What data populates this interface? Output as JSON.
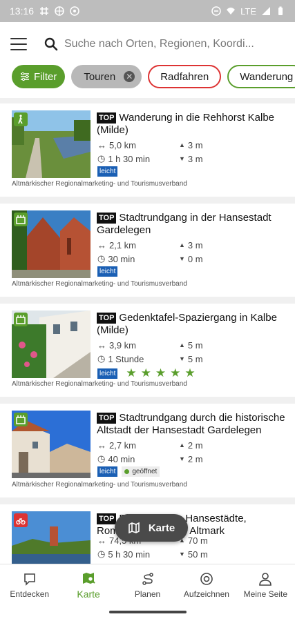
{
  "status_bar": {
    "time": "13:16",
    "network": "LTE"
  },
  "search": {
    "placeholder": "Suche nach Orten, Regionen, Koordi..."
  },
  "chips": {
    "filter": "Filter",
    "active": "Touren",
    "cycling": "Radfahren",
    "hiking": "Wanderung"
  },
  "tours": [
    {
      "top": "TOP",
      "title": "Wanderung in die Rehhorst Kalbe (Milde)",
      "distance": "5,0 km",
      "duration": "1 h 30 min",
      "ascent": "3 m",
      "descent": "3 m",
      "difficulty": "leicht",
      "org": "Altmärkischer Regionalmarketing- und Tourismusverband",
      "category_icon": "hiking-icon",
      "category_color": "#5a9e2c"
    },
    {
      "top": "TOP",
      "title": "Stadtrundgang in der Hansestadt Gardelegen",
      "distance": "2,1 km",
      "duration": "30 min",
      "ascent": "3 m",
      "descent": "0 m",
      "difficulty": "leicht",
      "org": "Altmärkischer Regionalmarketing- und Tourismusverband",
      "category_icon": "city-walk-icon",
      "category_color": "#5a9e2c"
    },
    {
      "top": "TOP",
      "title": "Gedenktafel-Spaziergang in Kalbe (Milde)",
      "distance": "3,9 km",
      "duration": "1 Stunde",
      "ascent": "5 m",
      "descent": "5 m",
      "difficulty": "leicht",
      "rating": 5,
      "org": "Altmärkischer Regionalmarketing- und Tourismusverband",
      "category_icon": "city-walk-icon",
      "category_color": "#5a9e2c"
    },
    {
      "top": "TOP",
      "title": "Stadtrundgang durch die historische Altstadt der Hansestadt Gardelegen",
      "distance": "2,7 km",
      "duration": "40 min",
      "ascent": "2 m",
      "descent": "2 m",
      "difficulty": "leicht",
      "status": "geöffnet",
      "org": "Altmärkischer Regionalmarketing- und Tourismusverband",
      "category_icon": "city-walk-icon",
      "category_color": "#5a9e2c"
    },
    {
      "top": "TOP",
      "title": "Elberadweg – Hansestädte, Romanik und ... der Altmark",
      "distance": "74,5 km",
      "duration": "5 h 30 min",
      "ascent": "70 m",
      "descent": "50 m",
      "category_icon": "cycling-icon",
      "category_color": "#d33"
    }
  ],
  "map_button": "Karte",
  "nav": [
    {
      "label": "Entdecken"
    },
    {
      "label": "Karte"
    },
    {
      "label": "Planen"
    },
    {
      "label": "Aufzeichnen"
    },
    {
      "label": "Meine Seite"
    }
  ],
  "colors": {
    "accent": "#5a9e2c",
    "difficulty_easy": "#1a5fb4",
    "cycling": "#dd3333"
  }
}
